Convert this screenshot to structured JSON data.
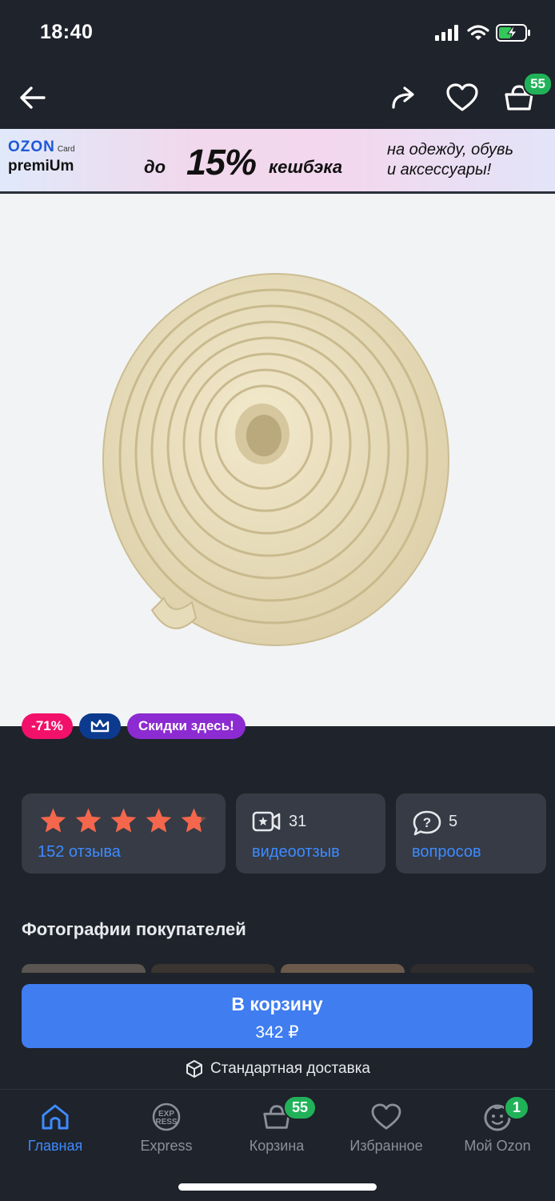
{
  "status_bar": {
    "time": "18:40"
  },
  "nav": {
    "cart_count": "55"
  },
  "banner": {
    "brand": "OZON",
    "card_word": "Card",
    "premium": "premiUm",
    "prefix": "до",
    "percent": "15%",
    "cashback": "кешбэка",
    "line1": "на одежду, обувь",
    "line2": "и аксессуары!"
  },
  "badges": {
    "discount": "-71%",
    "sale": "Скидки здесь!"
  },
  "rating": {
    "stars": 4.5,
    "reviews": "152 отзыва"
  },
  "video": {
    "count": "31",
    "label": "видеоотзыв"
  },
  "questions": {
    "count": "5",
    "label": "вопросов"
  },
  "customer_photos": {
    "title": "Фотографии покупателей"
  },
  "cart_button": {
    "label": "В корзину",
    "price": "342 ₽"
  },
  "delivery": {
    "label": "Стандартная доставка"
  },
  "tabs": [
    {
      "label": "Главная",
      "icon": "home-icon",
      "active": true
    },
    {
      "label": "Express",
      "icon": "express-icon"
    },
    {
      "label": "Корзина",
      "icon": "cart-icon",
      "badge": "55"
    },
    {
      "label": "Избранное",
      "icon": "heart-icon"
    },
    {
      "label": "Мой Ozon",
      "icon": "profile-icon",
      "badge": "1"
    }
  ],
  "colors": {
    "accent": "#3f7df1",
    "badge_green": "#21b259",
    "star": "#f4674c",
    "background": "#1f232b"
  }
}
